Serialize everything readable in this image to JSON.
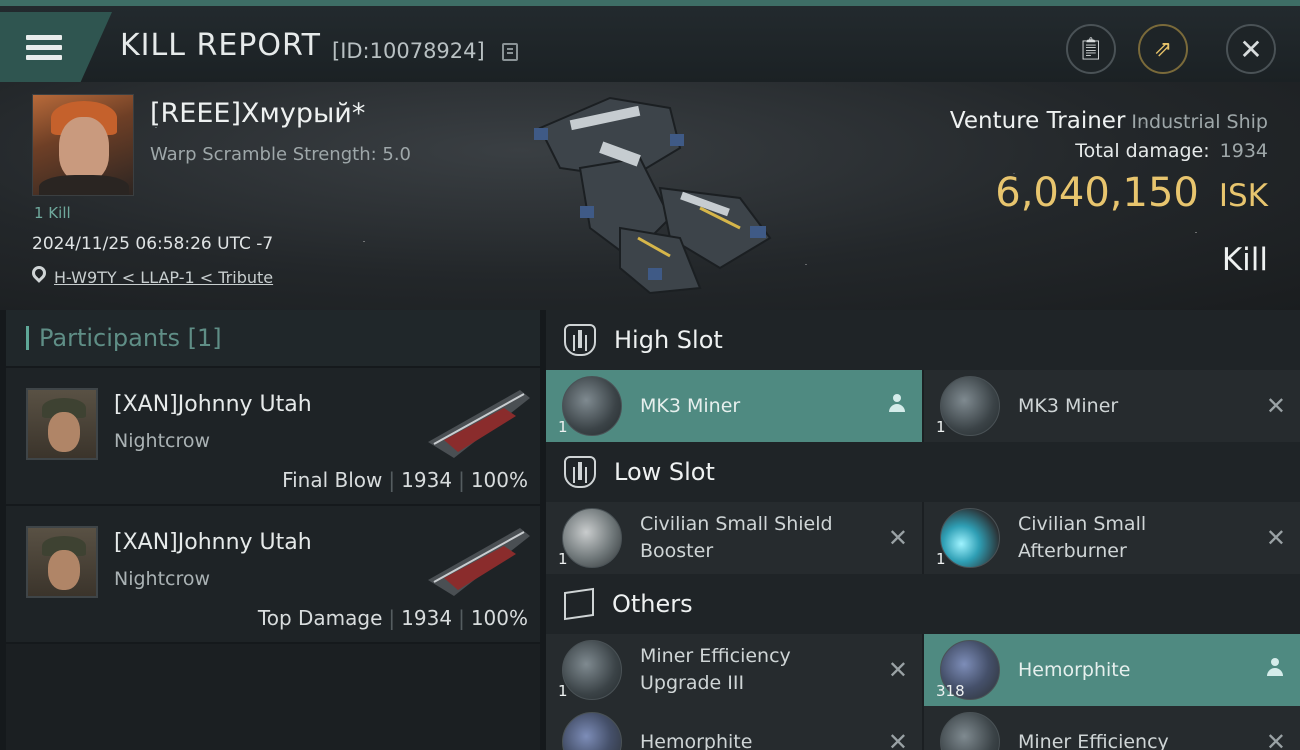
{
  "header": {
    "title": "KILL REPORT",
    "report_id": "[ID:10078924]"
  },
  "victim": {
    "name": "[REEE]Хмурый*",
    "warp_scramble": "Warp Scramble Strength: 5.0",
    "kills": "1 Kill",
    "datetime": "2024/11/25 06:58:26 UTC -7",
    "location": "H-W9TY < LLAP-1 < Tribute"
  },
  "ship": {
    "name": "Venture Trainer",
    "class": "Industrial Ship",
    "total_damage_label": "Total damage:",
    "total_damage": "1934",
    "isk_value": "6,040,150",
    "isk_unit": "ISK",
    "result": "Kill"
  },
  "participants": {
    "label": "Participants",
    "count": "[1]",
    "rows": [
      {
        "name": "[XAN]Johnny Utah",
        "ship": "Nightcrow",
        "role": "Final Blow",
        "damage": "1934",
        "percent": "100%"
      },
      {
        "name": "[XAN]Johnny Utah",
        "ship": "Nightcrow",
        "role": "Top Damage",
        "damage": "1934",
        "percent": "100%"
      }
    ],
    "separator": "|"
  },
  "fittings": {
    "high_slot": {
      "label": "High Slot",
      "items": [
        {
          "name": "MK3 Miner",
          "qty": "1",
          "icon": "miner-icon"
        },
        {
          "name": "MK3 Miner",
          "qty": "1",
          "icon": "miner-icon"
        }
      ]
    },
    "low_slot": {
      "label": "Low Slot",
      "items": [
        {
          "name": "Civilian Small Shield Booster",
          "qty": "1",
          "icon": "shield-booster-icon"
        },
        {
          "name": "Civilian Small Afterburner",
          "qty": "1",
          "icon": "afterburner-icon"
        }
      ]
    },
    "others": {
      "label": "Others",
      "items": [
        {
          "name": "Miner Efficiency Upgrade III",
          "qty": "1",
          "icon": "miner-upgrade-icon"
        },
        {
          "name": "Hemorphite",
          "qty": "318",
          "icon": "ore-icon"
        },
        {
          "name": "Hemorphite",
          "qty": "",
          "icon": "ore-icon"
        },
        {
          "name": "Miner Efficiency",
          "qty": "",
          "icon": "miner-upgrade-icon"
        }
      ]
    }
  },
  "colors": {
    "accent": "#4f8a81",
    "isk": "#e8c56e",
    "header_stripe": "#3e6e66"
  }
}
